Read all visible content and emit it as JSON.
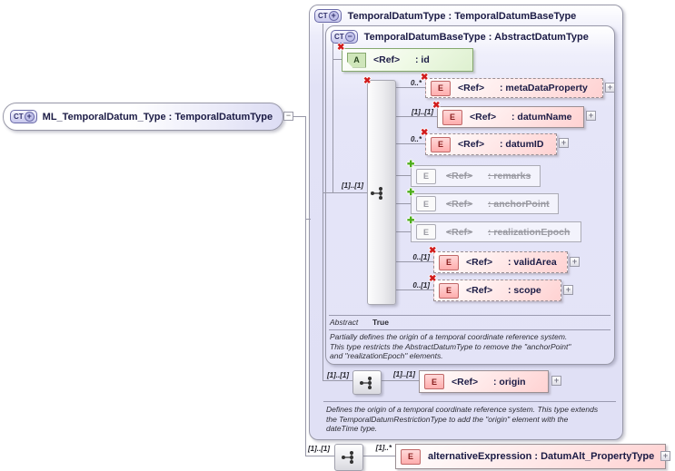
{
  "icons": {
    "complex_type": "CT",
    "extension_sign": "+",
    "restriction_sign": "−",
    "attribute": "A",
    "element": "E",
    "removed": "✖",
    "added": "✚",
    "expand": "+",
    "collapse": "−"
  },
  "ml_box": {
    "title": "ML_TemporalDatum_Type : TemporalDatumType"
  },
  "outer_box": {
    "title": "TemporalDatumType : TemporalDatumBaseType",
    "annotation_lines": [
      "Defines the origin of a temporal coordinate reference system. This type extends",
      "the TemporalDatumRestrictionType to add the \"origin\" element with the",
      "dateTime type."
    ]
  },
  "inner_box": {
    "title": "TemporalDatumBaseType : AbstractDatumType",
    "abstract_label": "Abstract",
    "abstract_value": "True",
    "group_cardinality": "[1]..[1]",
    "annotation_lines": [
      "Partially defines the origin of a temporal coordinate reference system.",
      "This type restricts the AbstractDatumType to remove the \"anchorPoint\"",
      "and \"realizationEpoch\" elements."
    ]
  },
  "id_attribute": {
    "ref": "<Ref>",
    "name": ": id"
  },
  "elements": [
    {
      "cardinality": "0..*",
      "ref": "<Ref>",
      "name": ": metaDataProperty"
    },
    {
      "cardinality": "[1]..[1]",
      "ref": "<Ref>",
      "name": ": datumName"
    },
    {
      "cardinality": "0..*",
      "ref": "<Ref>",
      "name": ": datumID"
    },
    {
      "cardinality": "",
      "ref": "<Ref>",
      "name": ": remarks"
    },
    {
      "cardinality": "",
      "ref": "<Ref>",
      "name": ": anchorPoint"
    },
    {
      "cardinality": "",
      "ref": "<Ref>",
      "name": ": realizationEpoch"
    },
    {
      "cardinality": "0..[1]",
      "ref": "<Ref>",
      "name": ": validArea"
    },
    {
      "cardinality": "0..[1]",
      "ref": "<Ref>",
      "name": ": scope"
    }
  ],
  "origin_row": {
    "group_cardinality": "[1]..[1]",
    "cardinality": "[1]..[1]",
    "ref": "<Ref>",
    "name": ": origin"
  },
  "alternative_row": {
    "group_cardinality": "[1]..[1]",
    "cardinality": "[1]..*",
    "name": "alternativeExpression : DatumAlt_PropertyType"
  },
  "colors": {
    "lavender": "#e4e4f7",
    "pink": "#ffd2d2",
    "green_attr": "#def0d0",
    "removed_red": "#d11c1c",
    "added_green": "#4fae1e",
    "text_navy": "#1b1b45"
  }
}
